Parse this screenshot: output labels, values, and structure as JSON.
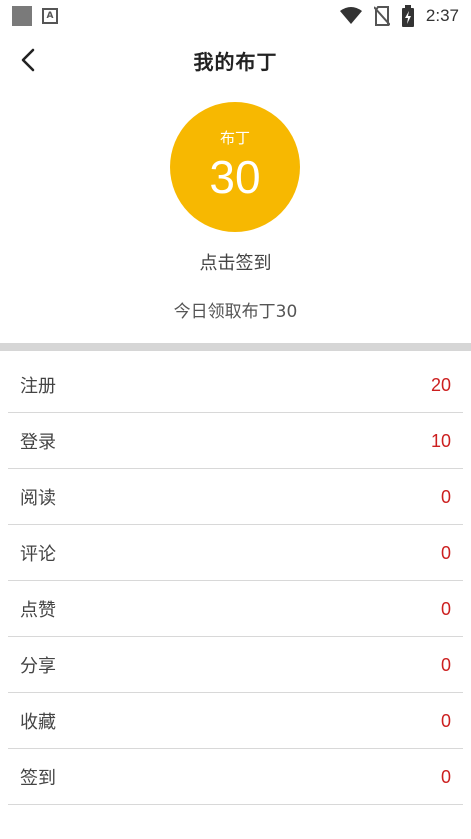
{
  "status_bar": {
    "time": "2:37",
    "icons": [
      "notification-square-icon",
      "a-badge-icon",
      "wifi-icon",
      "no-sim-icon",
      "battery-charging-icon"
    ]
  },
  "header": {
    "title": "我的布丁",
    "back_icon": "chevron-left-icon"
  },
  "balance": {
    "label": "布丁",
    "value": "30",
    "color": "#f7b801"
  },
  "checkin": {
    "action_label": "点击签到",
    "today_text": "今日领取布丁30"
  },
  "value_color": "#cc1f1f",
  "items": [
    {
      "label": "注册",
      "value": "20"
    },
    {
      "label": "登录",
      "value": "10"
    },
    {
      "label": "阅读",
      "value": "0"
    },
    {
      "label": "评论",
      "value": "0"
    },
    {
      "label": "点赞",
      "value": "0"
    },
    {
      "label": "分享",
      "value": "0"
    },
    {
      "label": "收藏",
      "value": "0"
    },
    {
      "label": "签到",
      "value": "0"
    }
  ]
}
